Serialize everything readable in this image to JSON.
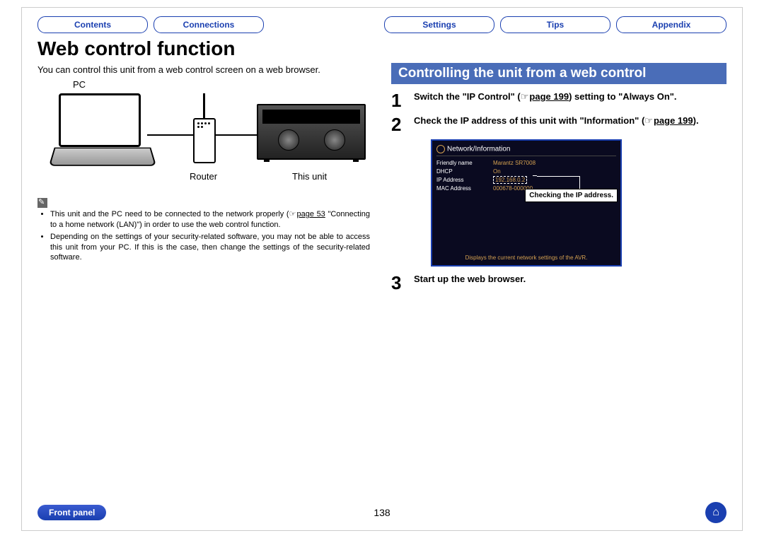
{
  "nav": {
    "contents": "Contents",
    "connections": "Connections",
    "playback": "",
    "settings": "Settings",
    "tips": "Tips",
    "appendix": "Appendix"
  },
  "title": "Web control function",
  "intro": "You can control this unit from a web control screen on a web browser.",
  "diagram": {
    "pc": "PC",
    "router": "Router",
    "unit": "This unit"
  },
  "notes": {
    "n1a": "This unit and the PC need to be connected to the network properly (",
    "n1link": "page 53",
    "n1b": " \"Connecting to a home network (LAN)\") in order to use the web control function.",
    "n2": "Depending on the settings of your security-related software, you may not be able to access this unit from your PC. If this is the case, then change the settings of the security-related software."
  },
  "section_heading": "Controlling the unit from a web control",
  "steps": {
    "s1": {
      "num": "1",
      "t1": "Switch the \"IP Control\" (",
      "link": "page 199",
      "t2": ") setting to \"Always On\"."
    },
    "s2": {
      "num": "2",
      "t1": "Check the IP address of this unit with \"Information\" (",
      "link": "page 199",
      "t2": ")."
    },
    "s3": {
      "num": "3",
      "t1": "Start up the web browser."
    }
  },
  "osd": {
    "title": "Network/Information",
    "rows": {
      "friendly_key": "Friendly name",
      "friendly_val": "Marantz SR7008",
      "dhcp_key": "DHCP",
      "dhcp_val": "On",
      "ip_key": "IP Address",
      "ip_val": "192.168.0.2",
      "mac_key": "MAC Address",
      "mac_val": "000678-000000"
    },
    "callout": "Checking the IP address.",
    "caption": "Displays the current network settings of the AVR."
  },
  "footer": {
    "front_panel": "Front panel",
    "page": "138"
  }
}
